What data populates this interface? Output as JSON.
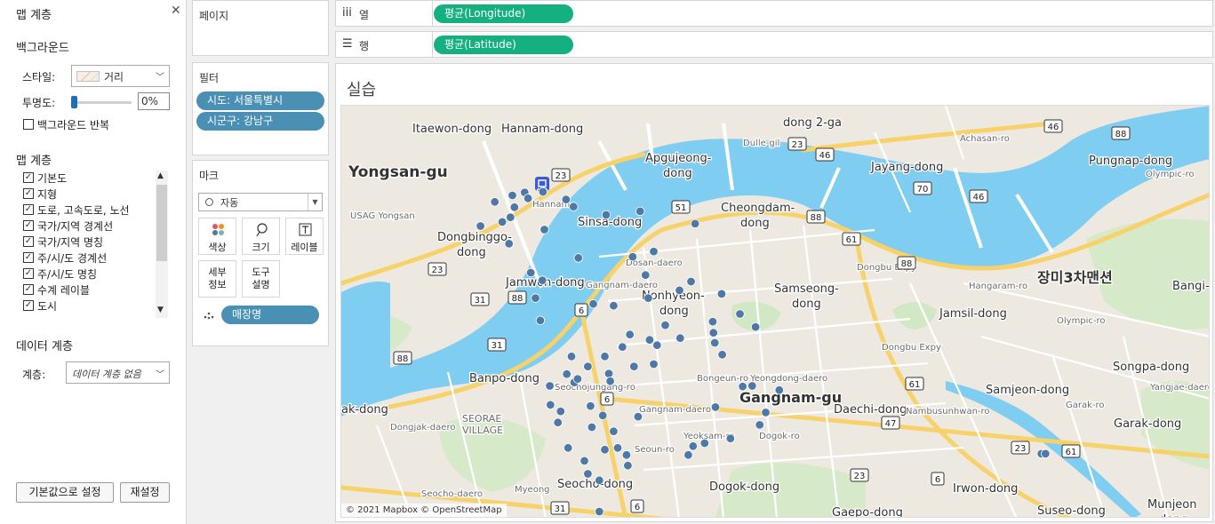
{
  "left_pane": {
    "title": "맵 계층",
    "background_section": "백그라운드",
    "style_label": "스타일:",
    "style_value": "거리",
    "opacity_label": "투명도:",
    "opacity_value": "0%",
    "opacity_fraction": 0.0,
    "repeat_label": "백그라운드 반복",
    "layers_section": "맵 계층",
    "layers": [
      {
        "label": "기본도",
        "checked": true
      },
      {
        "label": "지형",
        "checked": true
      },
      {
        "label": "도로, 고속도로, 노선",
        "checked": true
      },
      {
        "label": "국가/지역 경계선",
        "checked": true
      },
      {
        "label": "국가/지역 명칭",
        "checked": true
      },
      {
        "label": "주/시/도 경계선",
        "checked": true
      },
      {
        "label": "주/시/도 명칭",
        "checked": true
      },
      {
        "label": "수계 레이블",
        "checked": true
      },
      {
        "label": "도시",
        "checked": true
      }
    ],
    "data_layer_section": "데이터 계층",
    "data_layer_label": "계층:",
    "data_layer_value": "데이터 계층 없음",
    "default_button": "기본값으로 설정",
    "reset_button": "재설정"
  },
  "pages_card": {
    "title": "페이지"
  },
  "filters_card": {
    "title": "필터",
    "filters": [
      "시도: 서울특별시",
      "시군구: 강남구"
    ]
  },
  "marks_card": {
    "title": "마크",
    "mark_type": "자동",
    "buttons": {
      "color": "색상",
      "size": "크기",
      "label": "레이블",
      "detail": "세부\n정보",
      "tooltip": "도구\n설명"
    },
    "detail_pill": "매장명"
  },
  "columns_shelf": {
    "label": "열",
    "pill": "평균(Longitude)"
  },
  "rows_shelf": {
    "label": "행",
    "pill": "평균(Latitude)"
  },
  "view": {
    "title": "실습",
    "attribution": "© 2021 Mapbox © OpenStreetMap",
    "map_labels": [
      {
        "t": "Itaewon-dong",
        "x": 80,
        "y": 17,
        "s": 13
      },
      {
        "t": "Hannam-dong",
        "x": 180,
        "y": 17,
        "s": 13
      },
      {
        "t": "dong 2-ga",
        "x": 497,
        "y": 10,
        "s": 13
      },
      {
        "t": "Yongsan-gu",
        "x": 8,
        "y": 63,
        "s": 17,
        "b": true
      },
      {
        "t": "Apgujeong-",
        "x": 342,
        "y": 50,
        "s": 13
      },
      {
        "t": "dong",
        "x": 362,
        "y": 67,
        "s": 13
      },
      {
        "t": "Jayang-dong",
        "x": 596,
        "y": 60,
        "s": 13
      },
      {
        "t": "Pungnap-dong",
        "x": 841,
        "y": 53,
        "s": 13
      },
      {
        "t": "Hannam",
        "x": 215,
        "y": 104,
        "s": 10
      },
      {
        "t": "USAG Yongsan",
        "x": 10,
        "y": 117,
        "s": 10
      },
      {
        "t": "Sinsa-dong",
        "x": 266,
        "y": 122,
        "s": 13
      },
      {
        "t": "Cheongdam-",
        "x": 427,
        "y": 106,
        "s": 13
      },
      {
        "t": "dong",
        "x": 449,
        "y": 123,
        "s": 13
      },
      {
        "t": "Dongbinggo-",
        "x": 108,
        "y": 139,
        "s": 13
      },
      {
        "t": "dong",
        "x": 130,
        "y": 156,
        "s": 13
      },
      {
        "t": "Jamwon-dong",
        "x": 185,
        "y": 190,
        "s": 13
      },
      {
        "t": "장미3차맨션",
        "x": 783,
        "y": 183,
        "s": 16,
        "b": true
      },
      {
        "t": "Nonhyeon-",
        "x": 338,
        "y": 205,
        "s": 13
      },
      {
        "t": "dong",
        "x": 358,
        "y": 222,
        "s": 13
      },
      {
        "t": "Samseong-",
        "x": 487,
        "y": 197,
        "s": 13
      },
      {
        "t": "dong",
        "x": 507,
        "y": 214,
        "s": 13
      },
      {
        "t": "Jamsil-dong",
        "x": 673,
        "y": 225,
        "s": 13
      },
      {
        "t": "Bangi-",
        "x": 935,
        "y": 194,
        "s": 13
      },
      {
        "t": "Banpo-dong",
        "x": 144,
        "y": 298,
        "s": 13
      },
      {
        "t": "Songpa-dong",
        "x": 868,
        "y": 285,
        "s": 13
      },
      {
        "t": "ak-dong",
        "x": 0,
        "y": 333,
        "s": 13
      },
      {
        "t": "Gangnam-gu",
        "x": 448,
        "y": 318,
        "s": 16,
        "b": true
      },
      {
        "t": "Daechi-dong",
        "x": 554,
        "y": 333,
        "s": 13
      },
      {
        "t": "Samjeon-dong",
        "x": 725,
        "y": 311,
        "s": 13
      },
      {
        "t": "SEORAE",
        "x": 136,
        "y": 345,
        "s": 11
      },
      {
        "t": "VILLAGE",
        "x": 136,
        "y": 358,
        "s": 11
      },
      {
        "t": "Garak-dong",
        "x": 869,
        "y": 349,
        "s": 13
      },
      {
        "t": "Seocho-dong",
        "x": 243,
        "y": 417,
        "s": 13
      },
      {
        "t": "Dogok-dong",
        "x": 414,
        "y": 420,
        "s": 13
      },
      {
        "t": "Irwon-dong",
        "x": 688,
        "y": 422,
        "s": 13
      },
      {
        "t": "Gaepo-dong",
        "x": 552,
        "y": 449,
        "s": 13
      },
      {
        "t": "Suseo-dong",
        "x": 783,
        "y": 447,
        "s": 13
      },
      {
        "t": "Munjeon",
        "x": 907,
        "y": 440,
        "s": 13
      },
      {
        "t": "dong",
        "x": 920,
        "y": 457,
        "s": 13
      },
      {
        "t": "Dulle-gil",
        "x": 452,
        "y": 35,
        "s": 10
      },
      {
        "t": "Achasan-ro",
        "x": 696,
        "y": 30,
        "s": 10
      },
      {
        "t": "Olympic-ro",
        "x": 905,
        "y": 70,
        "s": 10
      },
      {
        "t": "Hangaram-ro",
        "x": 706,
        "y": 196,
        "s": 10
      },
      {
        "t": "Olympic-ro",
        "x": 805,
        "y": 235,
        "s": 10
      },
      {
        "t": "Dongbu Expy",
        "x": 580,
        "y": 175,
        "s": 10
      },
      {
        "t": "Dongbu Expy",
        "x": 608,
        "y": 265,
        "s": 10
      },
      {
        "t": "Nambusunhwan-ro",
        "x": 635,
        "y": 337,
        "s": 10
      },
      {
        "t": "Garak-ro",
        "x": 815,
        "y": 330,
        "s": 10
      },
      {
        "t": "Yangjae-daero",
        "x": 910,
        "y": 310,
        "s": 10
      },
      {
        "t": "Gangnam-daero",
        "x": 275,
        "y": 195,
        "s": 10
      },
      {
        "t": "Gangnam-daero",
        "x": 335,
        "y": 335,
        "s": 10
      },
      {
        "t": "Dosan-daero",
        "x": 320,
        "y": 170,
        "s": 10
      },
      {
        "t": "Yeoksam-ro",
        "x": 385,
        "y": 365,
        "s": 10
      },
      {
        "t": "Dogok-ro",
        "x": 470,
        "y": 365,
        "s": 10
      },
      {
        "t": "Seocho-daero",
        "x": 90,
        "y": 430,
        "s": 10
      },
      {
        "t": "Seochojungang-ro",
        "x": 240,
        "y": 310,
        "s": 10
      },
      {
        "t": "Seoun-ro",
        "x": 330,
        "y": 380,
        "s": 10
      },
      {
        "t": "Dongjak-daero",
        "x": 55,
        "y": 355,
        "s": 10
      },
      {
        "t": "Myeong",
        "x": 195,
        "y": 425,
        "s": 10
      },
      {
        "t": "Bongeun-ro",
        "x": 400,
        "y": 300,
        "s": 10
      },
      {
        "t": "Yeongdong-daero",
        "x": 460,
        "y": 300,
        "s": 10
      }
    ],
    "road_shields": [
      {
        "n": "23",
        "x": 513,
        "y": 43
      },
      {
        "n": "46",
        "x": 544,
        "y": 55
      },
      {
        "n": "46",
        "x": 801,
        "y": 23
      },
      {
        "n": "88",
        "x": 877,
        "y": 31
      },
      {
        "n": "70",
        "x": 654,
        "y": 93
      },
      {
        "n": "46",
        "x": 717,
        "y": 102
      },
      {
        "n": "23",
        "x": 247,
        "y": 78
      },
      {
        "n": "51",
        "x": 382,
        "y": 114
      },
      {
        "n": "88",
        "x": 534,
        "y": 125
      },
      {
        "n": "61",
        "x": 574,
        "y": 150
      },
      {
        "n": "88",
        "x": 636,
        "y": 177
      },
      {
        "n": "23",
        "x": 108,
        "y": 184
      },
      {
        "n": "31",
        "x": 156,
        "y": 218
      },
      {
        "n": "88",
        "x": 198,
        "y": 216
      },
      {
        "n": "6",
        "x": 270,
        "y": 230
      },
      {
        "n": "31",
        "x": 175,
        "y": 269
      },
      {
        "n": "88",
        "x": 69,
        "y": 284
      },
      {
        "n": "6",
        "x": 299,
        "y": 330
      },
      {
        "n": "61",
        "x": 645,
        "y": 313
      },
      {
        "n": "47",
        "x": 618,
        "y": 357
      },
      {
        "n": "23",
        "x": 764,
        "y": 385
      },
      {
        "n": "61",
        "x": 821,
        "y": 389
      },
      {
        "n": "23",
        "x": 583,
        "y": 416
      },
      {
        "n": "6",
        "x": 671,
        "y": 420
      },
      {
        "n": "31",
        "x": 246,
        "y": 453
      },
      {
        "n": "6",
        "x": 333,
        "y": 451
      }
    ]
  },
  "chart_data": {
    "type": "scatter",
    "x_field": "평균(Longitude)",
    "y_field": "평균(Latitude)",
    "detail_field": "매장명",
    "filters": [
      "시도: 서울특별시",
      "시군구: 강남구"
    ],
    "xlim": [
      127.002,
      127.13
    ],
    "ylim": [
      37.47,
      37.54
    ],
    "marker_color": "#4e79a7",
    "points": [
      {
        "x": 127.0272,
        "y": 37.5248
      },
      {
        "x": 127.029,
        "y": 37.5253
      },
      {
        "x": 127.0295,
        "y": 37.5243
      },
      {
        "x": 127.0317,
        "y": 37.5254
      },
      {
        "x": 127.0246,
        "y": 37.5237
      },
      {
        "x": 127.0275,
        "y": 37.5228
      },
      {
        "x": 127.0351,
        "y": 37.5241
      },
      {
        "x": 127.0362,
        "y": 37.5229
      },
      {
        "x": 127.0269,
        "y": 37.5211
      },
      {
        "x": 127.0257,
        "y": 37.5203
      },
      {
        "x": 127.0225,
        "y": 37.5196
      },
      {
        "x": 127.0319,
        "y": 37.519
      },
      {
        "x": 127.041,
        "y": 37.5215
      },
      {
        "x": 127.046,
        "y": 37.5221
      },
      {
        "x": 127.0541,
        "y": 37.52
      },
      {
        "x": 127.0267,
        "y": 37.5166
      },
      {
        "x": 127.0369,
        "y": 37.5142
      },
      {
        "x": 127.0449,
        "y": 37.5144
      },
      {
        "x": 127.048,
        "y": 37.5153
      },
      {
        "x": 127.0299,
        "y": 37.5117
      },
      {
        "x": 127.0316,
        "y": 37.5104
      },
      {
        "x": 127.0468,
        "y": 37.5113
      },
      {
        "x": 127.0535,
        "y": 37.5102
      },
      {
        "x": 127.0518,
        "y": 37.5087
      },
      {
        "x": 127.0472,
        "y": 37.5074
      },
      {
        "x": 127.0421,
        "y": 37.5061
      },
      {
        "x": 127.0391,
        "y": 37.5064
      },
      {
        "x": 127.0306,
        "y": 37.5074
      },
      {
        "x": 127.058,
        "y": 37.5081
      },
      {
        "x": 127.0607,
        "y": 37.5047
      },
      {
        "x": 127.0567,
        "y": 37.5034
      },
      {
        "x": 127.0497,
        "y": 37.5028
      },
      {
        "x": 127.0313,
        "y": 37.5036
      },
      {
        "x": 127.063,
        "y": 37.5025
      },
      {
        "x": 127.0568,
        "y": 37.5015
      },
      {
        "x": 127.0519,
        "y": 37.5006
      },
      {
        "x": 127.0485,
        "y": 37.4994
      },
      {
        "x": 127.0445,
        "y": 37.5012
      },
      {
        "x": 127.0474,
        "y": 37.5003
      },
      {
        "x": 127.057,
        "y": 37.4998
      },
      {
        "x": 127.0581,
        "y": 37.4978
      },
      {
        "x": 127.0434,
        "y": 37.4991
      },
      {
        "x": 127.0408,
        "y": 37.4975
      },
      {
        "x": 127.0359,
        "y": 37.4975
      },
      {
        "x": 127.0383,
        "y": 37.4958
      },
      {
        "x": 127.0451,
        "y": 37.4958
      },
      {
        "x": 127.0352,
        "y": 37.4945
      },
      {
        "x": 127.048,
        "y": 37.4962
      },
      {
        "x": 127.0414,
        "y": 37.4946
      },
      {
        "x": 127.0327,
        "y": 37.4925
      },
      {
        "x": 127.0363,
        "y": 37.4931
      },
      {
        "x": 127.0368,
        "y": 37.4937
      },
      {
        "x": 127.0416,
        "y": 37.4933
      },
      {
        "x": 127.0611,
        "y": 37.4924
      },
      {
        "x": 127.0625,
        "y": 37.4925
      },
      {
        "x": 127.0665,
        "y": 37.4918
      },
      {
        "x": 127.0328,
        "y": 37.4893
      },
      {
        "x": 127.0343,
        "y": 37.4882
      },
      {
        "x": 127.0387,
        "y": 37.4891
      },
      {
        "x": 127.0457,
        "y": 37.4873
      },
      {
        "x": 127.0405,
        "y": 37.4875
      },
      {
        "x": 127.0571,
        "y": 37.4889
      },
      {
        "x": 127.0636,
        "y": 37.4859
      },
      {
        "x": 127.0645,
        "y": 37.488
      },
      {
        "x": 127.0339,
        "y": 37.4863
      },
      {
        "x": 127.0389,
        "y": 37.4855
      },
      {
        "x": 127.0421,
        "y": 37.4848
      },
      {
        "x": 127.0555,
        "y": 37.4828
      },
      {
        "x": 127.0354,
        "y": 37.482
      },
      {
        "x": 127.0427,
        "y": 37.482
      },
      {
        "x": 127.0408,
        "y": 37.4817
      },
      {
        "x": 127.0593,
        "y": 37.4836
      },
      {
        "x": 127.044,
        "y": 37.4808
      },
      {
        "x": 127.0442,
        "y": 37.479
      },
      {
        "x": 127.1051,
        "y": 37.481
      },
      {
        "x": 127.1057,
        "y": 37.481
      },
      {
        "x": 127.0531,
        "y": 37.4808
      },
      {
        "x": 127.0378,
        "y": 37.4798
      },
      {
        "x": 127.0538,
        "y": 37.4823
      },
      {
        "x": 127.0383,
        "y": 37.4776
      },
      {
        "x": 127.04,
        "y": 37.4765
      },
      {
        "x": 127.04,
        "y": 37.4712
      }
    ]
  }
}
